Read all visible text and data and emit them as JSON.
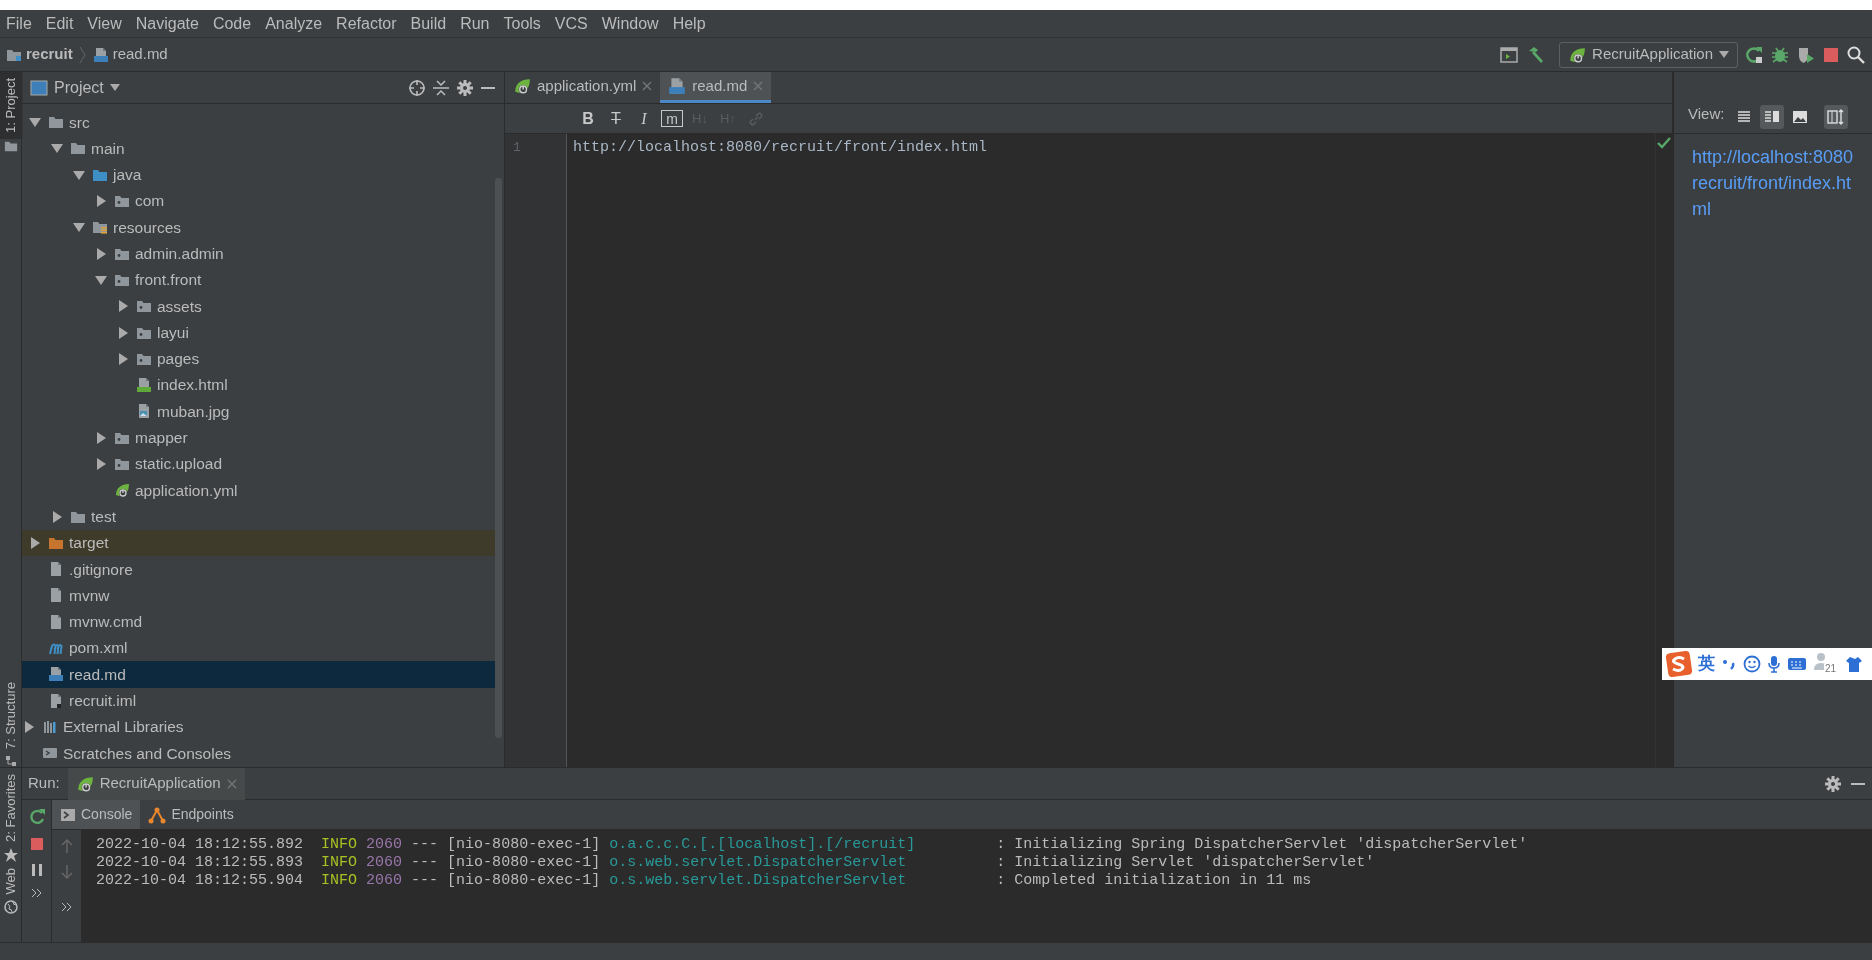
{
  "menu": [
    "File",
    "Edit",
    "View",
    "Navigate",
    "Code",
    "Analyze",
    "Refactor",
    "Build",
    "Run",
    "Tools",
    "VCS",
    "Window",
    "Help"
  ],
  "breadcrumb": [
    {
      "label": "recruit",
      "kind": "project"
    },
    {
      "label": "read.md",
      "kind": "markdown"
    }
  ],
  "run_config": {
    "label": "RecruitApplication"
  },
  "side_tabs_top": [
    {
      "label": "1: Project",
      "selected": true
    }
  ],
  "side_tabs_bottom": [
    {
      "label": "7: Structure",
      "selected": false
    }
  ],
  "side_tabs_run": [
    {
      "label": "2: Favorites",
      "kind": "star",
      "selected": false
    },
    {
      "label": "Web",
      "kind": "globe",
      "selected": false
    }
  ],
  "project_panel": {
    "title": "Project"
  },
  "tree": [
    {
      "children": [
        {
          "label": "src",
          "kind": "folder",
          "expanded": true,
          "selected": false,
          "children": [
            {
              "label": "main",
              "kind": "folder",
              "expanded": true,
              "selected": false,
              "children": [
                {
                  "label": "java",
                  "kind": "source-folder",
                  "expanded": true,
                  "selected": false,
                  "children": [
                    {
                      "label": "com",
                      "kind": "package",
                      "expanded": false,
                      "selected": false
                    }
                  ]
                },
                {
                  "label": "resources",
                  "kind": "resources",
                  "expanded": true,
                  "selected": false,
                  "children": [
                    {
                      "label": "admin.admin",
                      "kind": "package",
                      "expanded": false,
                      "selected": false
                    },
                    {
                      "label": "front.front",
                      "kind": "package",
                      "expanded": true,
                      "selected": false,
                      "children": [
                        {
                          "label": "assets",
                          "kind": "package",
                          "expanded": false,
                          "selected": false
                        },
                        {
                          "label": "layui",
                          "kind": "package",
                          "expanded": false,
                          "selected": false
                        },
                        {
                          "label": "pages",
                          "kind": "package",
                          "expanded": false,
                          "selected": false
                        },
                        {
                          "label": "index.html",
                          "kind": "html",
                          "selected": false
                        },
                        {
                          "label": "muban.jpg",
                          "kind": "image",
                          "selected": false
                        }
                      ]
                    },
                    {
                      "label": "mapper",
                      "kind": "package",
                      "expanded": false,
                      "selected": false
                    },
                    {
                      "label": "static.upload",
                      "kind": "package",
                      "expanded": false,
                      "selected": false
                    },
                    {
                      "label": "application.yml",
                      "kind": "spring",
                      "selected": false
                    }
                  ]
                }
              ]
            },
            {
              "label": "test",
              "kind": "folder",
              "expanded": false,
              "selected": false
            }
          ]
        },
        {
          "label": "target",
          "kind": "excluded",
          "expanded": false,
          "selected": false
        },
        {
          "label": ".gitignore",
          "kind": "file",
          "selected": false
        },
        {
          "label": "mvnw",
          "kind": "file",
          "selected": false
        },
        {
          "label": "mvnw.cmd",
          "kind": "file",
          "selected": false
        },
        {
          "label": "pom.xml",
          "kind": "maven",
          "selected": false
        },
        {
          "label": "read.md",
          "kind": "markdown",
          "selected": true
        },
        {
          "label": "recruit.iml",
          "kind": "iml",
          "selected": false
        }
      ]
    },
    {
      "label": "External Libraries",
      "kind": "libraries",
      "expanded": false,
      "selected": false
    },
    {
      "label": "Scratches and Consoles",
      "kind": "scratches",
      "selected": false
    }
  ],
  "editor_tabs": [
    {
      "label": "application.yml",
      "kind": "spring",
      "selected": false
    },
    {
      "label": "read.md",
      "kind": "markdown",
      "selected": true
    }
  ],
  "markdown_tools": [
    {
      "kind": "bold",
      "glyph": "B",
      "disabled": false
    },
    {
      "kind": "strike",
      "glyph": "T",
      "disabled": false
    },
    {
      "kind": "italic",
      "glyph": "I",
      "disabled": false
    },
    {
      "kind": "code",
      "glyph": "m",
      "disabled": false
    },
    {
      "kind": "header-down",
      "glyph": "H↓",
      "disabled": true
    },
    {
      "kind": "header-up",
      "glyph": "H↑",
      "disabled": true
    },
    {
      "kind": "link",
      "disabled": true
    }
  ],
  "editor": {
    "lines": [
      {
        "number": "1",
        "text": "http://localhost:8080/recruit/front/index.html"
      }
    ]
  },
  "preview": {
    "view_label": "View:",
    "modes": [
      {
        "kind": "editor",
        "selected": false
      },
      {
        "kind": "split",
        "selected": true
      },
      {
        "kind": "preview",
        "selected": false
      }
    ],
    "sync_scroll": true,
    "lines": [
      "http://localhost:8080",
      "recruit/front/index.ht",
      "ml"
    ]
  },
  "ime": {
    "language": "英",
    "badge": "21"
  },
  "run_panel": {
    "label": "Run:",
    "tab": {
      "label": "RecruitApplication"
    },
    "subtabs": [
      {
        "label": "Console",
        "kind": "console",
        "selected": true
      },
      {
        "label": "Endpoints",
        "kind": "endpoints",
        "selected": false
      }
    ],
    "log": [
      {
        "time": "2022-10-04 18:12:55.892",
        "level": "INFO",
        "pid": "2060",
        "sep": "---",
        "thread": "[nio-8080-exec-1]",
        "logger": "o.a.c.c.C.[.[localhost].[/recruit]",
        "message": ": Initializing Spring DispatcherServlet 'dispatcherServlet'"
      },
      {
        "time": "2022-10-04 18:12:55.893",
        "level": "INFO",
        "pid": "2060",
        "sep": "---",
        "thread": "[nio-8080-exec-1]",
        "logger": "o.s.web.servlet.DispatcherServlet",
        "message": ": Initializing Servlet 'dispatcherServlet'"
      },
      {
        "time": "2022-10-04 18:12:55.904",
        "level": "INFO",
        "pid": "2060",
        "sep": "---",
        "thread": "[nio-8080-exec-1]",
        "logger": "o.s.web.servlet.DispatcherServlet",
        "message": ": Completed initialization in 11 ms"
      }
    ]
  }
}
